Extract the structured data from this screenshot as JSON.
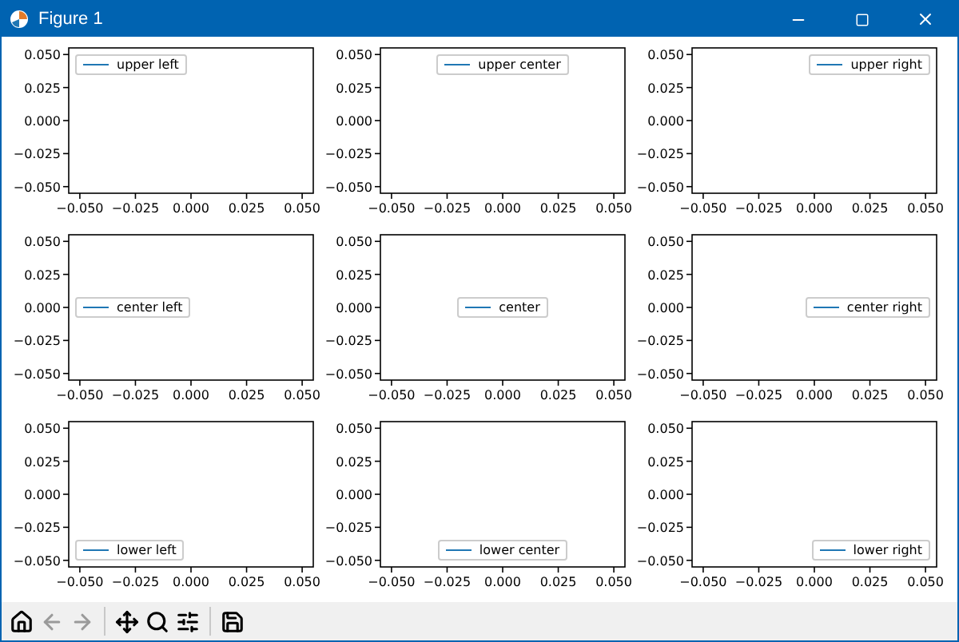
{
  "window": {
    "title": "Figure 1"
  },
  "subplots": [
    {
      "legend": [
        {
          "label": "upper left",
          "color": "#1f77b4"
        }
      ],
      "xticks": [
        "−0.050",
        "−0.025",
        "0.000",
        "0.025",
        "0.050"
      ],
      "yticks": [
        "0.050",
        "0.025",
        "0.000",
        "−0.025",
        "−0.050"
      ]
    },
    {
      "legend": [
        {
          "label": "upper center",
          "color": "#1f77b4"
        }
      ],
      "xticks": [
        "−0.050",
        "−0.025",
        "0.000",
        "0.025",
        "0.050"
      ],
      "yticks": [
        "0.050",
        "0.025",
        "0.000",
        "−0.025",
        "−0.050"
      ]
    },
    {
      "legend": [
        {
          "label": "upper right",
          "color": "#1f77b4"
        }
      ],
      "xticks": [
        "−0.050",
        "−0.025",
        "0.000",
        "0.025",
        "0.050"
      ],
      "yticks": [
        "0.050",
        "0.025",
        "0.000",
        "−0.025",
        "−0.050"
      ]
    },
    {
      "legend": [
        {
          "label": "center left",
          "color": "#1f77b4"
        }
      ],
      "xticks": [
        "−0.050",
        "−0.025",
        "0.000",
        "0.025",
        "0.050"
      ],
      "yticks": [
        "0.050",
        "0.025",
        "0.000",
        "−0.025",
        "−0.050"
      ]
    },
    {
      "legend": [
        {
          "label": "center",
          "color": "#1f77b4"
        }
      ],
      "xticks": [
        "−0.050",
        "−0.025",
        "0.000",
        "0.025",
        "0.050"
      ],
      "yticks": [
        "0.050",
        "0.025",
        "0.000",
        "−0.025",
        "−0.050"
      ]
    },
    {
      "legend": [
        {
          "label": "center right",
          "color": "#1f77b4"
        }
      ],
      "xticks": [
        "−0.050",
        "−0.025",
        "0.000",
        "0.025",
        "0.050"
      ],
      "yticks": [
        "0.050",
        "0.025",
        "0.000",
        "−0.025",
        "−0.050"
      ]
    },
    {
      "legend": [
        {
          "label": "lower left",
          "color": "#1f77b4"
        }
      ],
      "xticks": [
        "−0.050",
        "−0.025",
        "0.000",
        "0.025",
        "0.050"
      ],
      "yticks": [
        "0.050",
        "0.025",
        "0.000",
        "−0.025",
        "−0.050"
      ]
    },
    {
      "legend": [
        {
          "label": "lower center",
          "color": "#1f77b4"
        }
      ],
      "xticks": [
        "−0.050",
        "−0.025",
        "0.000",
        "0.025",
        "0.050"
      ],
      "yticks": [
        "0.050",
        "0.025",
        "0.000",
        "−0.025",
        "−0.050"
      ]
    },
    {
      "legend": [
        {
          "label": "lower right",
          "color": "#1f77b4"
        }
      ],
      "xticks": [
        "−0.050",
        "−0.025",
        "0.000",
        "0.025",
        "0.050"
      ],
      "yticks": [
        "0.050",
        "0.025",
        "0.000",
        "−0.025",
        "−0.050"
      ]
    }
  ],
  "toolbar": [
    [
      {
        "kind": "home",
        "disabled": false
      },
      {
        "kind": "back",
        "disabled": true
      },
      {
        "kind": "forward",
        "disabled": true
      }
    ],
    [
      {
        "kind": "pan",
        "disabled": false
      },
      {
        "kind": "zoom",
        "disabled": false
      },
      {
        "kind": "configure",
        "disabled": false
      }
    ],
    [
      {
        "kind": "save",
        "disabled": false
      }
    ]
  ]
}
